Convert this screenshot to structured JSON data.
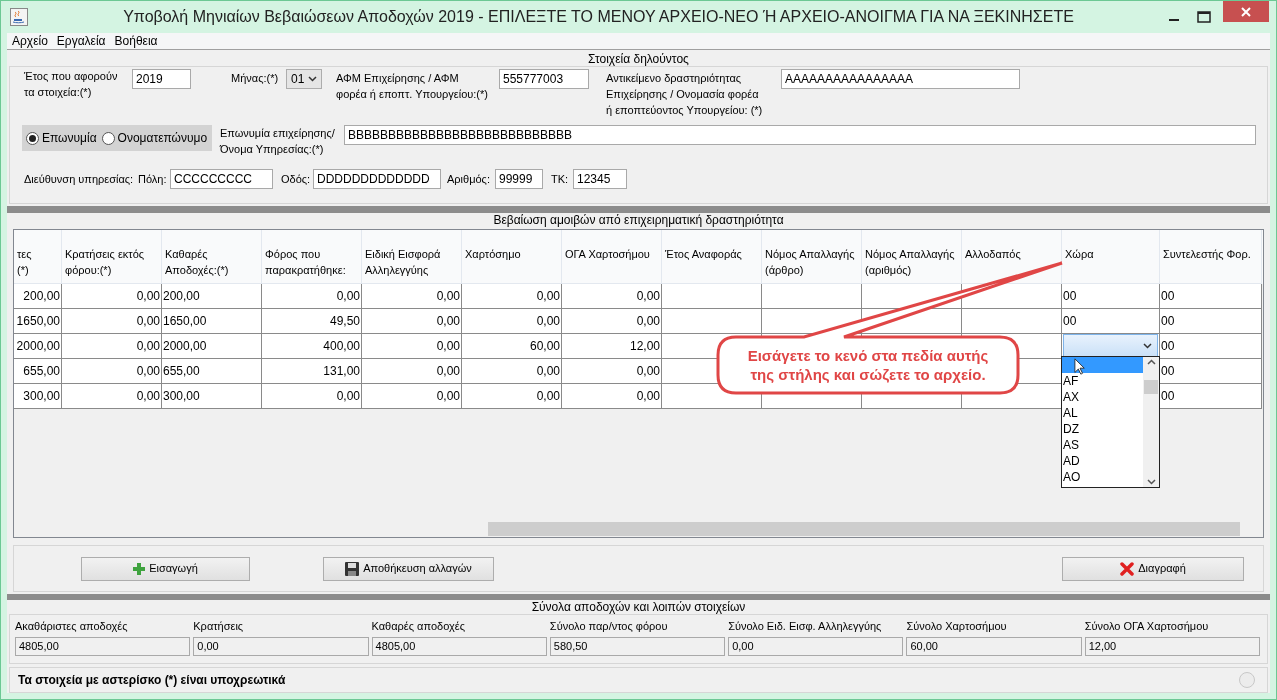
{
  "window": {
    "title": "Υποβολή Μηνιαίων Βεβαιώσεων Αποδοχών 2019 - ΕΠΙΛΕΞΤΕ ΤΟ ΜΕΝΟΥ ΑΡΧΕΙΟ-ΝΕΟ Ή ΑΡΧΕΙΟ-ΑΝΟΙΓΜΑ ΓΙΑ ΝΑ ΞΕΚΙΝΗΣΕΤΕ"
  },
  "menu": [
    "Αρχείο",
    "Εργαλεία",
    "Βοήθεια"
  ],
  "declarant": {
    "title": "Στοιχεία δηλούντος",
    "year": {
      "label": "Έτος που αφορούν\nτα στοιχεία:(*)",
      "value": "2019"
    },
    "month": {
      "label": "Μήνας:(*)",
      "value": "01"
    },
    "afm": {
      "label": "ΑΦΜ Επιχείρησης / ΑΦΜ\nφορέα ή εποπτ. Υπουργείου:(*)",
      "value": "555777003"
    },
    "activity": {
      "label": "Αντικείμενο δραστηριότητας\nΕπιχείρησης / Ονομασία φορέα\nή εποπτεύοντος Υπουργείου: (*)",
      "value": "AAAAAAAAAAAAAAAA"
    },
    "name_type": [
      {
        "label": "Επωνυμία",
        "selected": true
      },
      {
        "label": "Ονοματεπώνυμο",
        "selected": false
      }
    ],
    "business_name": {
      "label": "Επωνυμία επιχείρησης/\nΌνομα Υπηρεσίας:(*)",
      "value": "BBBBBBBBBBBBBBBBBBBBBBBBBBBB"
    },
    "address": {
      "label": "Διεύθυνση υπηρεσίας:",
      "fields": [
        {
          "label": "Πόλη:",
          "value": "CCCCCCCCC"
        },
        {
          "label": "Οδός:",
          "value": "DDDDDDDDDDDDD"
        },
        {
          "label": "Αριθμός:",
          "value": "99999"
        },
        {
          "label": "ΤΚ:",
          "value": "12345"
        }
      ]
    }
  },
  "earnings": {
    "title": "Βεβαίωση αμοιβών από επιχειρηματική δραστηριότητα",
    "table": {
      "columns": [
        {
          "label": "τες\n(*)"
        },
        {
          "label": "Κρατήσεις εκτός\nφόρου:(*)"
        },
        {
          "label": "Καθαρές\nΑποδοχές:(*)"
        },
        {
          "label": "Φόρος που\nπαρακρατήθηκε:"
        },
        {
          "label": "Ειδική Εισφορά\nΑλληλεγγύης"
        },
        {
          "label": "Χαρτόσημο"
        },
        {
          "label": "ΟΓΑ Χαρτοσήμου"
        },
        {
          "label": "Έτος Αναφοράς"
        },
        {
          "label": "Νόμος Απαλλαγής\n(άρθρο)"
        },
        {
          "label": "Νόμος Απαλλαγής\n(αριθμός)"
        },
        {
          "label": "Αλλοδαπός"
        },
        {
          "label": "Χώρα"
        },
        {
          "label": "Συντελεστής Φορ."
        }
      ],
      "rows": [
        [
          "200,00",
          "0,00",
          "200,00",
          "0,00",
          "0,00",
          "0,00",
          "0,00",
          null,
          null,
          null,
          null,
          "00",
          "00"
        ],
        [
          "1650,00",
          "0,00",
          "1650,00",
          "49,50",
          "0,00",
          "0,00",
          "0,00",
          null,
          null,
          null,
          null,
          "00",
          "00"
        ],
        [
          "2000,00",
          "0,00",
          "2000,00",
          "400,00",
          "0,00",
          "60,00",
          "12,00",
          null,
          null,
          null,
          null,
          {
            "kind": "combo"
          },
          "00"
        ],
        [
          "655,00",
          "0,00",
          "655,00",
          "131,00",
          "0,00",
          "0,00",
          "0,00",
          null,
          null,
          null,
          null,
          null,
          "00"
        ],
        [
          "300,00",
          "0,00",
          "300,00",
          "0,00",
          "0,00",
          "0,00",
          "0,00",
          null,
          null,
          null,
          null,
          null,
          "00"
        ]
      ]
    },
    "dropdown": [
      {
        "selected": true
      },
      {
        "label": "AF",
        "selected": false
      },
      {
        "label": "AX",
        "selected": false
      },
      {
        "label": "AL",
        "selected": false
      },
      {
        "label": "DZ",
        "selected": false
      },
      {
        "label": "AS",
        "selected": false
      },
      {
        "label": "AD",
        "selected": false
      },
      {
        "label": "AO",
        "selected": false
      }
    ],
    "callout": "Εισάγετε το κενό στα πεδία αυτής\nτης στήλης και σώζετε το αρχείο.",
    "buttons": [
      {
        "label": "Εισαγωγή",
        "kind": "add"
      },
      {
        "label": "Αποθήκευση αλλαγών",
        "kind": "save"
      },
      {
        "label": "Διαγραφή",
        "kind": "delete"
      }
    ]
  },
  "totals": {
    "title": "Σύνολα αποδοχών και λοιπών στοιχείων",
    "items": [
      {
        "label": "Ακαθάριστες αποδοχές",
        "value": "4805,00"
      },
      {
        "label": "Κρατήσεις",
        "value": "0,00"
      },
      {
        "label": "Καθαρές αποδοχές",
        "value": "4805,00"
      },
      {
        "label": "Σύνολο παρ/ντος φόρου",
        "value": "580,50"
      },
      {
        "label": "Σύνολο Ειδ. Εισφ. Αλληλεγγύης",
        "value": "0,00"
      },
      {
        "label": "Σύνολο Χαρτοσήμου",
        "value": "60,00"
      },
      {
        "label": "Σύνολο ΟΓΑ Χαρτοσήμου",
        "value": "12,00"
      }
    ]
  },
  "footer": "Τα στοιχεία με αστερίσκο (*) είναι υποχρεωτικά"
}
